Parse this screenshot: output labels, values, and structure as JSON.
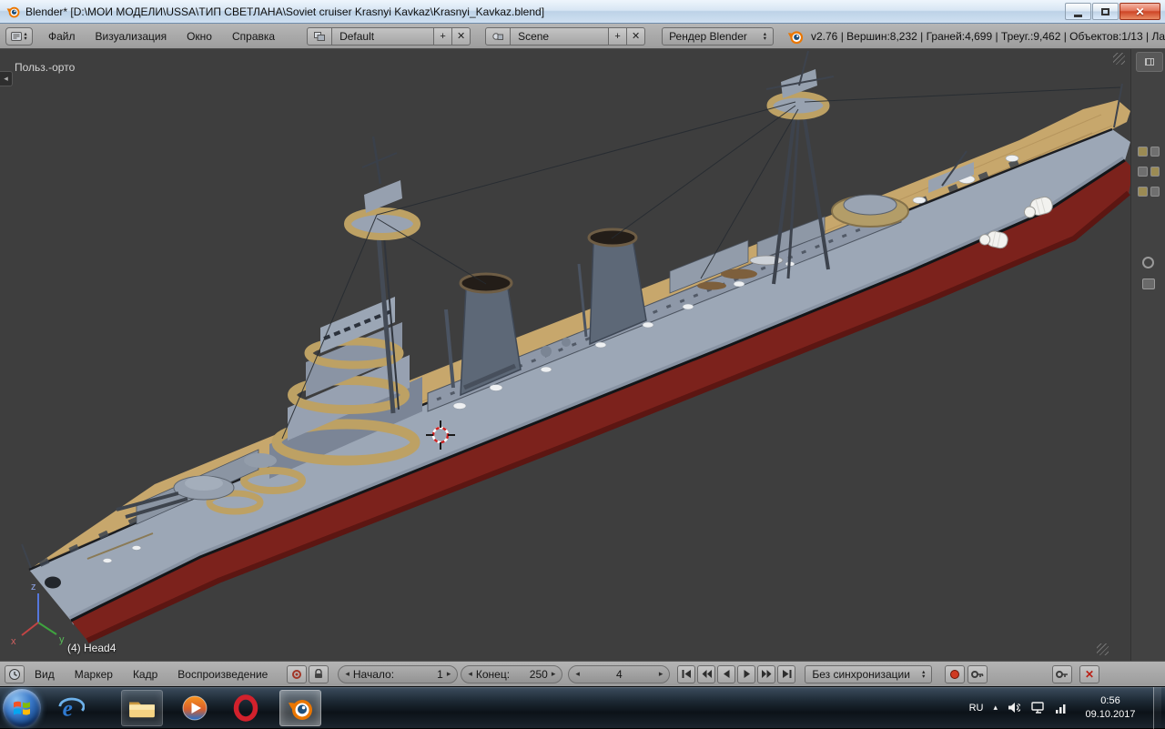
{
  "titlebar": {
    "title": "Blender* [D:\\МОИ МОДЕЛИ\\USSA\\ТИП СВЕТЛАНА\\Soviet cruiser Krasnyi Kavkaz\\Krasnyi_Kavkaz.blend]"
  },
  "icons": {
    "close_glyph": "✕",
    "up_arrow": "▴",
    "down_arrow": "▾",
    "left_arrow": "◂",
    "right_arrow": "▸",
    "plus": "+",
    "unlink": "✕",
    "tray_hidden": "▴"
  },
  "info_header": {
    "menus": [
      "Файл",
      "Визуализация",
      "Окно",
      "Справка"
    ],
    "layout_value": "Default",
    "scene_value": "Scene",
    "render_engine": "Рендер Blender",
    "stats": "v2.76 | Вершин:8,232 | Граней:4,699 | Треуг.:9,462 | Объектов:1/13 | Ла"
  },
  "viewport": {
    "view_mode_label": "Польз.-орто",
    "active_object_label": "(4) Head4",
    "axis": {
      "x": "x",
      "y": "y",
      "z": "z"
    }
  },
  "timeline": {
    "menus": [
      "Вид",
      "Маркер",
      "Кадр",
      "Воспроизведение"
    ],
    "start_label": "Начало:",
    "start_value": "1",
    "end_label": "Конец:",
    "end_value": "250",
    "frame_value": "4",
    "sync_value": "Без синхронизации"
  },
  "taskbar": {
    "language": "RU",
    "time": "0:56",
    "date": "09.10.2017"
  }
}
